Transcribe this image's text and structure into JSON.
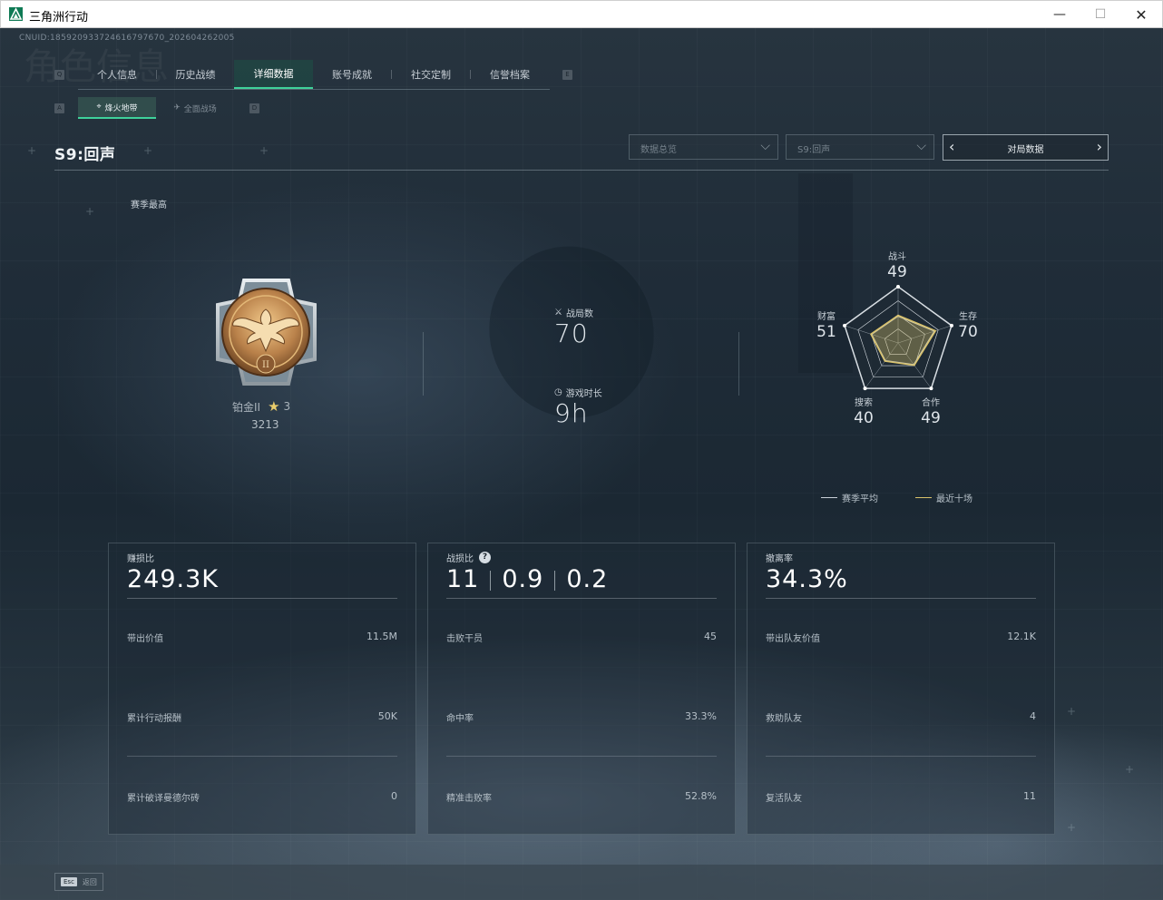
{
  "window": {
    "title": "三角洲行动",
    "controls": {
      "minimize": "—",
      "maximize": "☐",
      "close": "✕"
    }
  },
  "header": {
    "cnuid": "CNUID:1859209337246167976​70_202604262005",
    "ghost_title": "角色信息",
    "key_left": "Q",
    "key_right": "E",
    "tabs": [
      {
        "label": "个人信息",
        "active": false
      },
      {
        "label": "历史战绩",
        "active": false
      },
      {
        "label": "详细数据",
        "active": true
      },
      {
        "label": "账号成就",
        "active": false
      },
      {
        "label": "社交定制",
        "active": false
      },
      {
        "label": "信誉档案",
        "active": false
      }
    ],
    "subkey_left": "A",
    "subkey_right": "D",
    "subtabs": [
      {
        "label": "烽火地带",
        "icon": "tactical-icon",
        "active": true
      },
      {
        "label": "全面战场",
        "icon": "plane-icon",
        "active": false
      }
    ]
  },
  "season": {
    "title": "S9:回声",
    "filter_data": "数据总览",
    "filter_season": "S9:回声",
    "pager_label": "对局数据",
    "best_label": "赛季最高"
  },
  "rank": {
    "name": "铂金II",
    "stars": "3",
    "score": "3213",
    "medal_numeral": "II"
  },
  "summary": {
    "matches_label": "战局数",
    "matches_value": "70",
    "time_label": "游戏时长",
    "time_value": "9h"
  },
  "radar": {
    "axes": [
      {
        "label": "战斗",
        "value": "49"
      },
      {
        "label": "生存",
        "value": "70"
      },
      {
        "label": "合作",
        "value": "49"
      },
      {
        "label": "搜索",
        "value": "40"
      },
      {
        "label": "财富",
        "value": "51"
      }
    ],
    "legend_avg": "赛季平均",
    "legend_recent": "最近十场",
    "color_avg": "#c9d1d8",
    "color_recent": "#d9c26a"
  },
  "panels": [
    {
      "title": "赚损比",
      "big": "249.3K",
      "rows": [
        {
          "label": "带出价值",
          "value": "11.5M"
        },
        {
          "label": "累计行动报酬",
          "value": "50K"
        },
        {
          "label": "累计破译曼德尔砖",
          "value": "0"
        }
      ]
    },
    {
      "title": "战损比",
      "help": "?",
      "big_parts": [
        "11",
        "0.9",
        "0.2"
      ],
      "rows": [
        {
          "label": "击败干员",
          "value": "45"
        },
        {
          "label": "命中率",
          "value": "33.3%"
        },
        {
          "label": "精准击败率",
          "value": "52.8%"
        }
      ]
    },
    {
      "title": "撤离率",
      "big": "34.3%",
      "rows": [
        {
          "label": "带出队友价值",
          "value": "12.1K"
        },
        {
          "label": "救助队友",
          "value": "4"
        },
        {
          "label": "复活队友",
          "value": "11"
        }
      ]
    }
  ],
  "footer": {
    "esc_key": "Esc",
    "esc_label": "返回"
  }
}
